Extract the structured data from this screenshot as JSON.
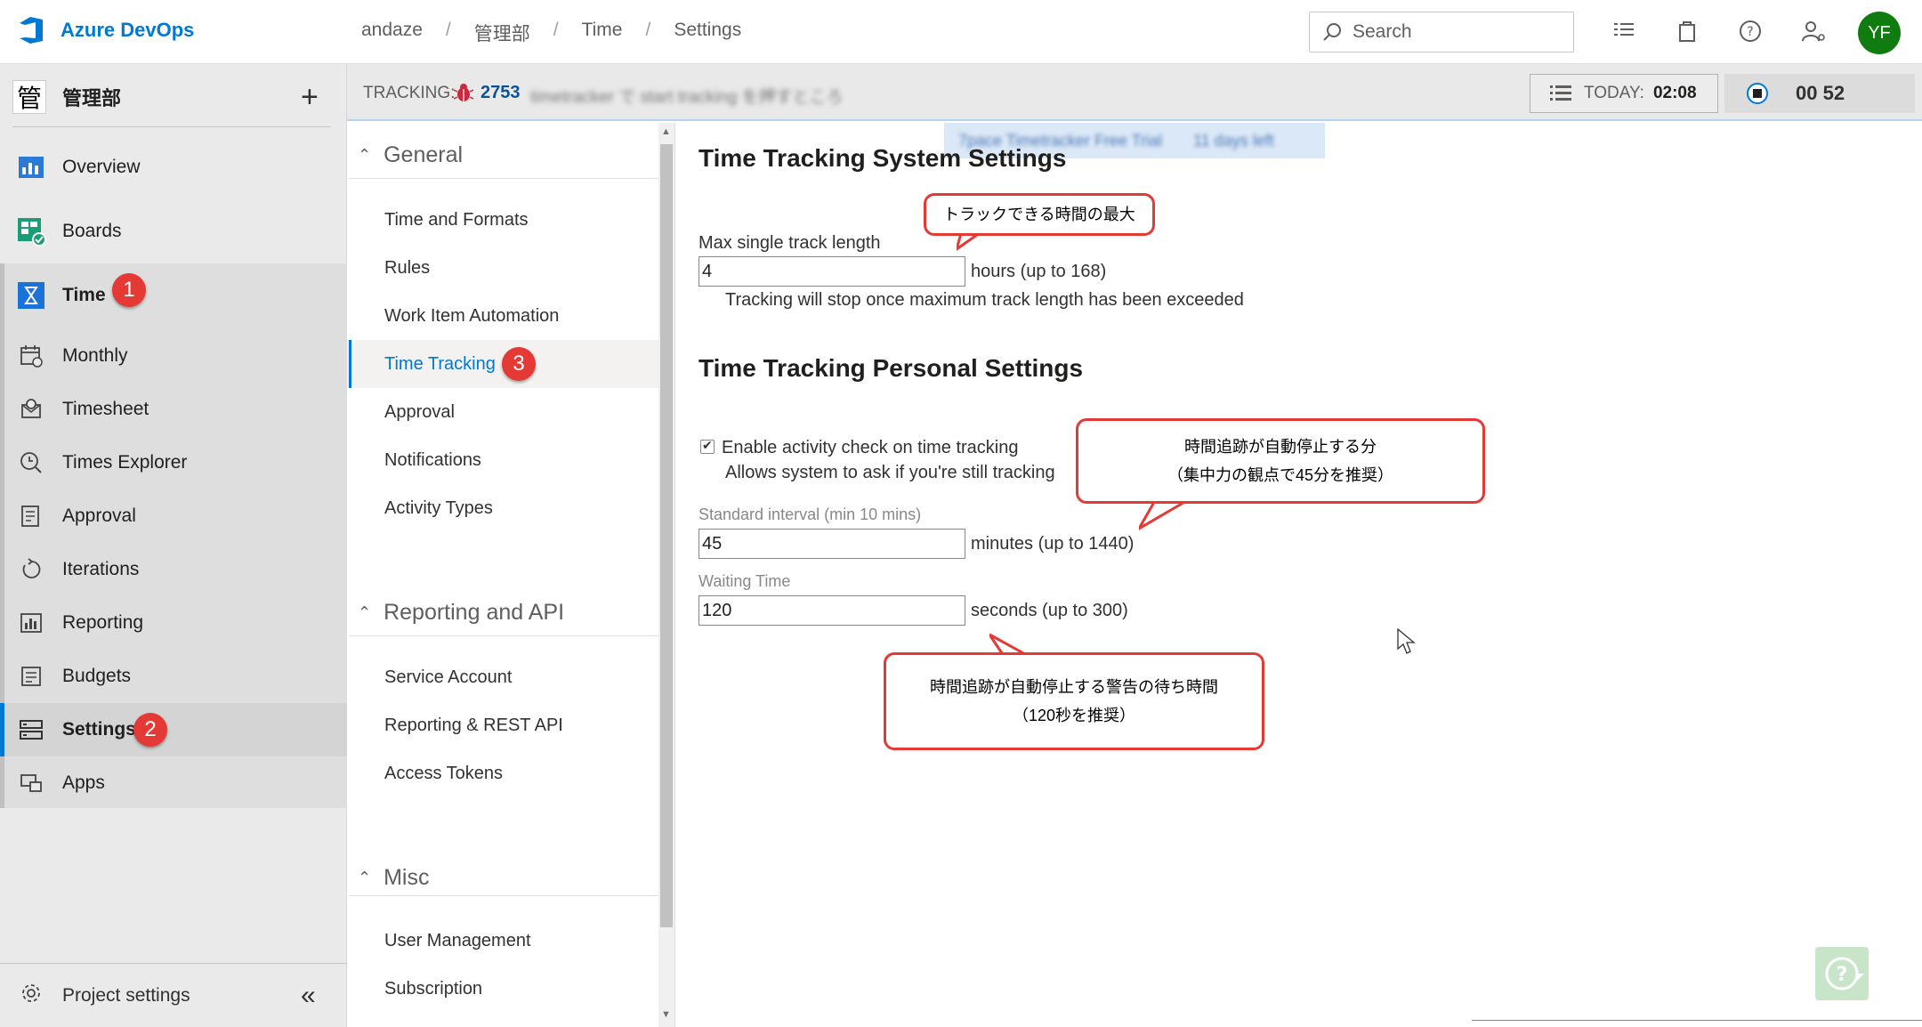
{
  "header": {
    "brand": "Azure DevOps",
    "breadcrumb": [
      "andaze",
      "管理部",
      "Time",
      "Settings"
    ],
    "breadcrumb_sep": "/",
    "search_placeholder": "Search",
    "avatar_initials": "YF"
  },
  "sidebar": {
    "project_initial": "管",
    "project_name": "管理部",
    "items": [
      {
        "label": "Overview",
        "icon": "overview-icon"
      },
      {
        "label": "Boards",
        "icon": "boards-icon"
      },
      {
        "label": "Time",
        "icon": "hourglass-icon"
      },
      {
        "label": "Monthly",
        "icon": "calendar-icon"
      },
      {
        "label": "Timesheet",
        "icon": "timesheet-icon"
      },
      {
        "label": "Times Explorer",
        "icon": "clock-search-icon"
      },
      {
        "label": "Approval",
        "icon": "approval-icon"
      },
      {
        "label": "Iterations",
        "icon": "iterations-icon"
      },
      {
        "label": "Reporting",
        "icon": "reporting-icon"
      },
      {
        "label": "Budgets",
        "icon": "budgets-icon"
      },
      {
        "label": "Settings",
        "icon": "settings-icon"
      },
      {
        "label": "Apps",
        "icon": "apps-icon"
      }
    ],
    "project_settings": "Project settings",
    "badges": {
      "time": "1",
      "settings": "2",
      "time_tracking": "3"
    }
  },
  "trackbar": {
    "label": "TRACKING:",
    "ticket_id": "2753",
    "ticket_title": "timetracker で start tracking を押すところ",
    "today_label": "TODAY:",
    "today_value": "02:08",
    "timer": "00 52"
  },
  "settings_menu": {
    "groups": [
      {
        "title": "General",
        "items": [
          "Time and Formats",
          "Rules",
          "Work Item Automation",
          "Time Tracking",
          "Approval",
          "Notifications",
          "Activity Types"
        ]
      },
      {
        "title": "Reporting and API",
        "items": [
          "Service Account",
          "Reporting & REST API",
          "Access Tokens"
        ]
      },
      {
        "title": "Misc",
        "items": [
          "User Management",
          "Subscription"
        ]
      }
    ],
    "active_item": "Time Tracking"
  },
  "trial_banner": {
    "text": "7pace Timetracker Free Trial",
    "days": "11 days left"
  },
  "content": {
    "system_title": "Time Tracking System Settings",
    "max_label": "Max single track length",
    "max_value": "4",
    "max_suffix": "hours (up to 168)",
    "max_help": "Tracking will stop once maximum track length has been exceeded",
    "personal_title": "Time Tracking Personal Settings",
    "activity_check_label": "Enable activity check on time tracking",
    "activity_check_checked": true,
    "activity_check_help": "Allows system to ask if you're still tracking",
    "interval_label": "Standard interval (min 10 mins)",
    "interval_value": "45",
    "interval_suffix": "minutes (up to 1440)",
    "waiting_label": "Waiting Time",
    "waiting_value": "120",
    "waiting_suffix": "seconds (up to 300)"
  },
  "callouts": {
    "max_track": "トラックできる時間の最大",
    "auto_stop_line1": "時間追跡が自動停止する分",
    "auto_stop_line2": "（集中力の観点で45分を推奨）",
    "warning_line1": "時間追跡が自動停止する警告の待ち時間",
    "warning_line2": "（120秒を推奨）"
  },
  "colors": {
    "accent": "#0078d4",
    "badge": "#e53935",
    "avatar": "#107c10",
    "callout_border": "#e53935"
  }
}
